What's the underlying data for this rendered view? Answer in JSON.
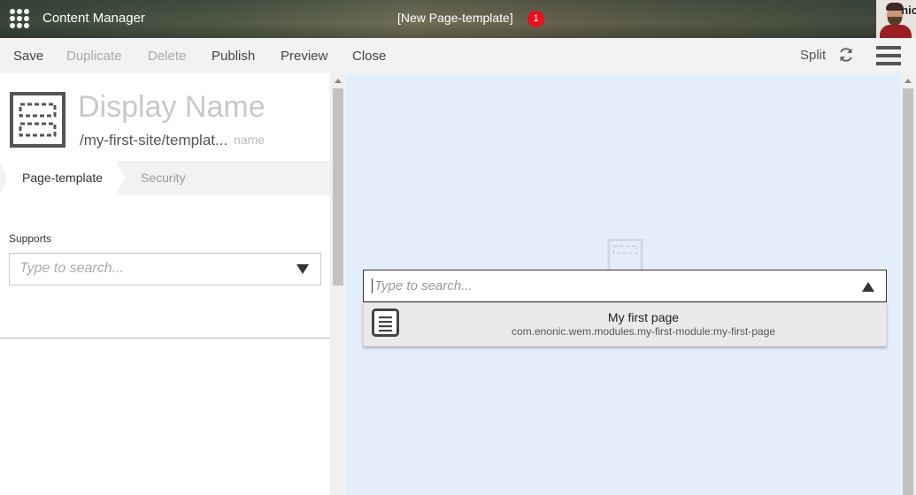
{
  "topbar": {
    "app_title": "Content Manager",
    "doc_title": "[New Page-template]",
    "notification_count": "1",
    "avatar_text": "nic"
  },
  "toolbar": {
    "save": "Save",
    "duplicate": "Duplicate",
    "delete": "Delete",
    "publish": "Publish",
    "preview": "Preview",
    "close": "Close",
    "split": "Split"
  },
  "form": {
    "display_name_placeholder": "Display Name",
    "path": "/my-first-site/templat...",
    "name_placeholder": "name",
    "tabs": [
      {
        "label": "Page-template",
        "active": true
      },
      {
        "label": "Security",
        "active": false
      }
    ],
    "supports_label": "Supports",
    "supports_placeholder": "Type to search..."
  },
  "preview": {
    "selector_placeholder": "Type to search...",
    "options": [
      {
        "title": "My first page",
        "subtitle": "com.enonic.wem.modules.my-first-module:my-first-page",
        "icon": "page-icon"
      }
    ]
  },
  "colors": {
    "preview_bg": "#e4eefa",
    "toolbar_bg": "#f2f2f2",
    "notification": "#e8101a"
  }
}
